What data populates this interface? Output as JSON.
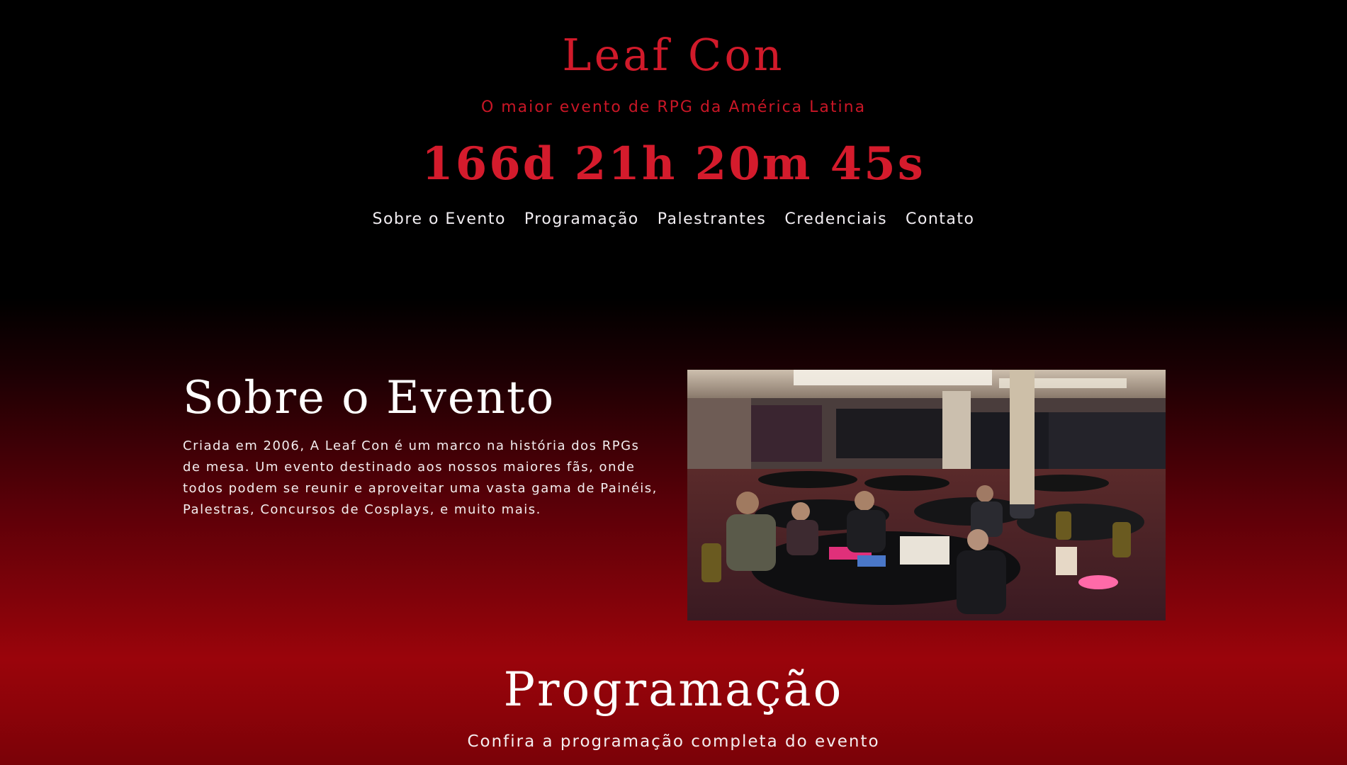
{
  "header": {
    "title": "Leaf Con",
    "tagline": "O maior evento de RPG da América Latina",
    "countdown": "166d 21h 20m 45s"
  },
  "nav": {
    "items": [
      {
        "label": "Sobre o Evento"
      },
      {
        "label": "Programação"
      },
      {
        "label": "Palestrantes"
      },
      {
        "label": "Credenciais"
      },
      {
        "label": "Contato"
      }
    ]
  },
  "about": {
    "title": "Sobre o Evento",
    "text": "Criada em 2006, A Leaf Con é um marco na história dos RPGs de mesa. Um evento destinado aos nossos maiores fãs, onde todos podem se reunir e aproveitar uma vasta gama de Painéis, Palestras, Concursos de Cosplays, e muito mais."
  },
  "programacao": {
    "title": "Programação",
    "subtitle": "Confira a programação completa do evento"
  },
  "colors": {
    "accent_red": "#d11a2a",
    "text_light": "#f2eef2",
    "background_top": "#000000",
    "background_bottom": "#9a040b"
  }
}
